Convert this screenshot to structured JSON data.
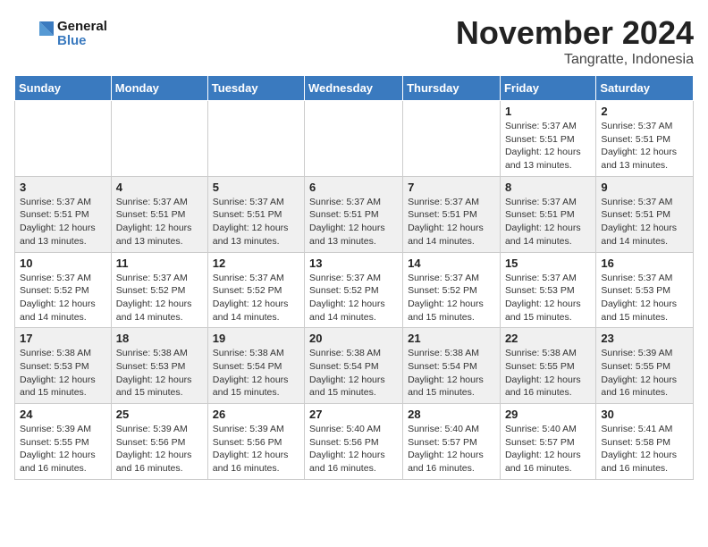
{
  "header": {
    "logo_general": "General",
    "logo_blue": "Blue",
    "month_title": "November 2024",
    "location": "Tangratte, Indonesia"
  },
  "days_of_week": [
    "Sunday",
    "Monday",
    "Tuesday",
    "Wednesday",
    "Thursday",
    "Friday",
    "Saturday"
  ],
  "weeks": [
    [
      {
        "day": "",
        "info": ""
      },
      {
        "day": "",
        "info": ""
      },
      {
        "day": "",
        "info": ""
      },
      {
        "day": "",
        "info": ""
      },
      {
        "day": "",
        "info": ""
      },
      {
        "day": "1",
        "info": "Sunrise: 5:37 AM\nSunset: 5:51 PM\nDaylight: 12 hours and 13 minutes."
      },
      {
        "day": "2",
        "info": "Sunrise: 5:37 AM\nSunset: 5:51 PM\nDaylight: 12 hours and 13 minutes."
      }
    ],
    [
      {
        "day": "3",
        "info": "Sunrise: 5:37 AM\nSunset: 5:51 PM\nDaylight: 12 hours and 13 minutes."
      },
      {
        "day": "4",
        "info": "Sunrise: 5:37 AM\nSunset: 5:51 PM\nDaylight: 12 hours and 13 minutes."
      },
      {
        "day": "5",
        "info": "Sunrise: 5:37 AM\nSunset: 5:51 PM\nDaylight: 12 hours and 13 minutes."
      },
      {
        "day": "6",
        "info": "Sunrise: 5:37 AM\nSunset: 5:51 PM\nDaylight: 12 hours and 13 minutes."
      },
      {
        "day": "7",
        "info": "Sunrise: 5:37 AM\nSunset: 5:51 PM\nDaylight: 12 hours and 14 minutes."
      },
      {
        "day": "8",
        "info": "Sunrise: 5:37 AM\nSunset: 5:51 PM\nDaylight: 12 hours and 14 minutes."
      },
      {
        "day": "9",
        "info": "Sunrise: 5:37 AM\nSunset: 5:51 PM\nDaylight: 12 hours and 14 minutes."
      }
    ],
    [
      {
        "day": "10",
        "info": "Sunrise: 5:37 AM\nSunset: 5:52 PM\nDaylight: 12 hours and 14 minutes."
      },
      {
        "day": "11",
        "info": "Sunrise: 5:37 AM\nSunset: 5:52 PM\nDaylight: 12 hours and 14 minutes."
      },
      {
        "day": "12",
        "info": "Sunrise: 5:37 AM\nSunset: 5:52 PM\nDaylight: 12 hours and 14 minutes."
      },
      {
        "day": "13",
        "info": "Sunrise: 5:37 AM\nSunset: 5:52 PM\nDaylight: 12 hours and 14 minutes."
      },
      {
        "day": "14",
        "info": "Sunrise: 5:37 AM\nSunset: 5:52 PM\nDaylight: 12 hours and 15 minutes."
      },
      {
        "day": "15",
        "info": "Sunrise: 5:37 AM\nSunset: 5:53 PM\nDaylight: 12 hours and 15 minutes."
      },
      {
        "day": "16",
        "info": "Sunrise: 5:37 AM\nSunset: 5:53 PM\nDaylight: 12 hours and 15 minutes."
      }
    ],
    [
      {
        "day": "17",
        "info": "Sunrise: 5:38 AM\nSunset: 5:53 PM\nDaylight: 12 hours and 15 minutes."
      },
      {
        "day": "18",
        "info": "Sunrise: 5:38 AM\nSunset: 5:53 PM\nDaylight: 12 hours and 15 minutes."
      },
      {
        "day": "19",
        "info": "Sunrise: 5:38 AM\nSunset: 5:54 PM\nDaylight: 12 hours and 15 minutes."
      },
      {
        "day": "20",
        "info": "Sunrise: 5:38 AM\nSunset: 5:54 PM\nDaylight: 12 hours and 15 minutes."
      },
      {
        "day": "21",
        "info": "Sunrise: 5:38 AM\nSunset: 5:54 PM\nDaylight: 12 hours and 15 minutes."
      },
      {
        "day": "22",
        "info": "Sunrise: 5:38 AM\nSunset: 5:55 PM\nDaylight: 12 hours and 16 minutes."
      },
      {
        "day": "23",
        "info": "Sunrise: 5:39 AM\nSunset: 5:55 PM\nDaylight: 12 hours and 16 minutes."
      }
    ],
    [
      {
        "day": "24",
        "info": "Sunrise: 5:39 AM\nSunset: 5:55 PM\nDaylight: 12 hours and 16 minutes."
      },
      {
        "day": "25",
        "info": "Sunrise: 5:39 AM\nSunset: 5:56 PM\nDaylight: 12 hours and 16 minutes."
      },
      {
        "day": "26",
        "info": "Sunrise: 5:39 AM\nSunset: 5:56 PM\nDaylight: 12 hours and 16 minutes."
      },
      {
        "day": "27",
        "info": "Sunrise: 5:40 AM\nSunset: 5:56 PM\nDaylight: 12 hours and 16 minutes."
      },
      {
        "day": "28",
        "info": "Sunrise: 5:40 AM\nSunset: 5:57 PM\nDaylight: 12 hours and 16 minutes."
      },
      {
        "day": "29",
        "info": "Sunrise: 5:40 AM\nSunset: 5:57 PM\nDaylight: 12 hours and 16 minutes."
      },
      {
        "day": "30",
        "info": "Sunrise: 5:41 AM\nSunset: 5:58 PM\nDaylight: 12 hours and 16 minutes."
      }
    ]
  ]
}
